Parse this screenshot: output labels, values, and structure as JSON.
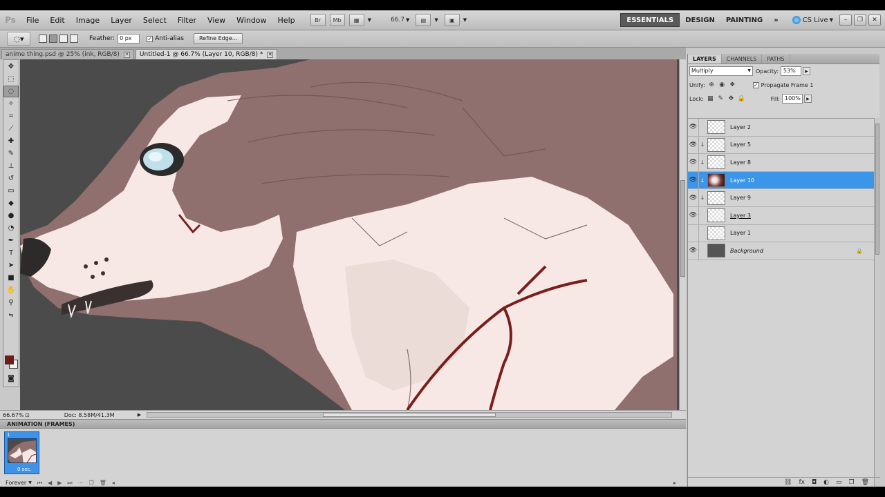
{
  "menubar": {
    "logo": "Ps",
    "items": [
      "File",
      "Edit",
      "Image",
      "Layer",
      "Select",
      "Filter",
      "View",
      "Window",
      "Help"
    ],
    "bridge": "Br",
    "minibridge": "Mb",
    "zoom": "66.7",
    "workspaces": [
      "ESSENTIALS",
      "DESIGN",
      "PAINTING"
    ],
    "more": "»",
    "cslive": "CS Live"
  },
  "options": {
    "feather_label": "Feather:",
    "feather_value": "0 px",
    "antialias_label": "Anti-alias",
    "refine_edge": "Refine Edge..."
  },
  "tabs": [
    {
      "label": "anime thing.psd @ 25% (ink, RGB/8)"
    },
    {
      "label": "Untitled-1 @ 66.7% (Layer 10, RGB/8) *"
    }
  ],
  "status": {
    "zoom": "66.67%",
    "doc": "Doc: 8.58M/41.3M"
  },
  "animation": {
    "title": "ANIMATION (FRAMES)",
    "frame_number": "1",
    "frame_delay": "0 sec.",
    "loop": "Forever"
  },
  "layers_panel": {
    "tabs": [
      "LAYERS",
      "CHANNELS",
      "PATHS"
    ],
    "blend_mode": "Multiply",
    "opacity_label": "Opacity:",
    "opacity_value": "53%",
    "unify_label": "Unify:",
    "propagate_label": "Propagate Frame 1",
    "lock_label": "Lock:",
    "fill_label": "Fill:",
    "fill_value": "100%",
    "layers": [
      {
        "name": "Layer 2",
        "visible": true,
        "clipped": false,
        "selected": false
      },
      {
        "name": "Layer 5",
        "visible": true,
        "clipped": true,
        "selected": false
      },
      {
        "name": "Layer 8",
        "visible": true,
        "clipped": true,
        "selected": false
      },
      {
        "name": "Layer 10",
        "visible": true,
        "clipped": true,
        "selected": true
      },
      {
        "name": "Layer 9",
        "visible": true,
        "clipped": true,
        "selected": false
      },
      {
        "name": "Layer 3",
        "visible": true,
        "clipped": false,
        "selected": false
      },
      {
        "name": "Layer 1",
        "visible": false,
        "clipped": false,
        "selected": false
      },
      {
        "name": "Background",
        "visible": true,
        "clipped": false,
        "selected": false
      }
    ]
  },
  "colors": {
    "foreground": "#6f1b17",
    "background": "#f5f0ee",
    "selection": "#3b96ea"
  }
}
